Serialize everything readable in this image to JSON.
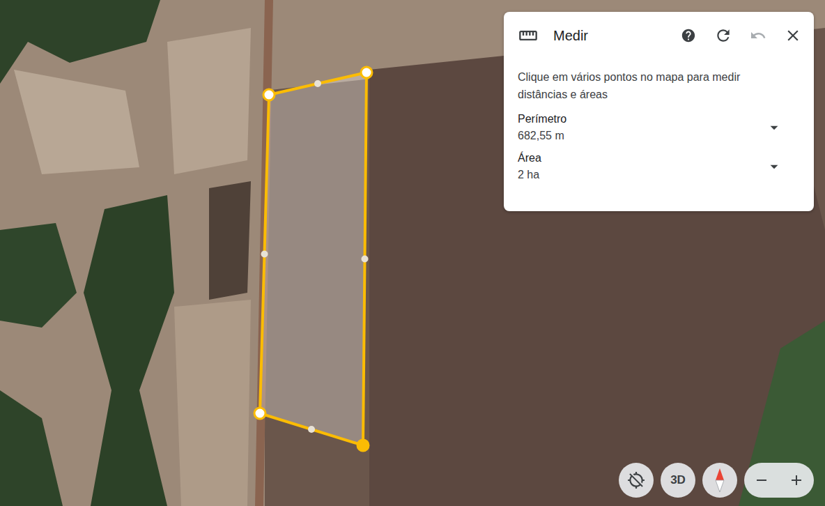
{
  "panel": {
    "title": "Medir",
    "help_text": "Clique em vários pontos no mapa para medir distâncias e áreas",
    "actions": [
      {
        "kind": "help",
        "disabled": false
      },
      {
        "kind": "reset",
        "disabled": false
      },
      {
        "kind": "undo",
        "disabled": true
      },
      {
        "kind": "close",
        "disabled": false
      }
    ],
    "measurements": [
      {
        "label": "Perímetro",
        "value": "682,55 m",
        "expanded": false
      },
      {
        "label": "Área",
        "value": "2 ha",
        "expanded": false
      }
    ]
  },
  "map_controls": {
    "view_mode": "3D"
  }
}
